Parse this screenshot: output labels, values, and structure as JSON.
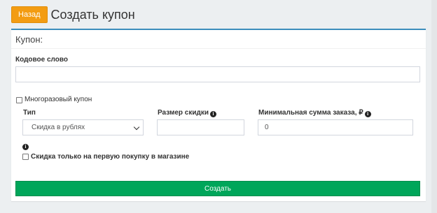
{
  "header": {
    "back_label": "Назад",
    "title": "Создать купон"
  },
  "box": {
    "title": "Купон:"
  },
  "form": {
    "code_label": "Кодовое слово",
    "code_value": "",
    "reusable_label": "Многоразовый купон",
    "reusable_checked": false,
    "type_label": "Тип",
    "type_selected": "Скидка в рублях",
    "discount_label": "Размер скидки",
    "discount_value": "",
    "min_sum_label": "Минимальная сумма заказа, ₽",
    "min_sum_value": "0",
    "first_purchase_label": "Скидка только на первую покупку в магазине",
    "first_purchase_checked": false,
    "info_icon_glyph": "i",
    "submit_label": "Создать"
  },
  "colors": {
    "back_button": "#f39c12",
    "box_top_border": "#3c8dbc",
    "submit_button": "#00a65a",
    "page_background": "#eceff1"
  }
}
